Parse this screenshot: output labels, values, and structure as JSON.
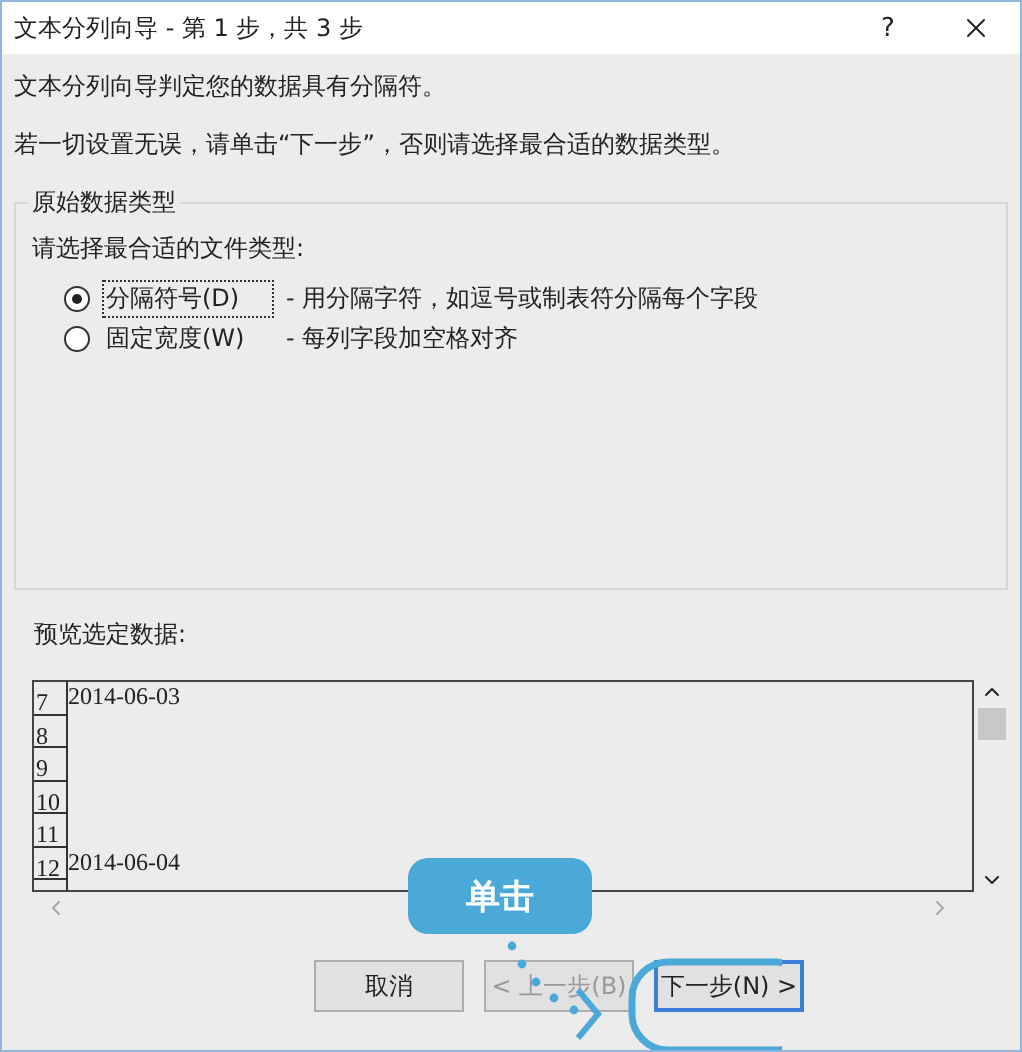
{
  "window": {
    "title": "文本分列向导 - 第 1 步，共 3 步",
    "help": "?"
  },
  "intro": [
    "文本分列向导判定您的数据具有分隔符。",
    "若一切设置无误，请单击“下一步”，否则请选择最合适的数据类型。"
  ],
  "group": {
    "title": "原始数据类型",
    "prompt": "请选择最合适的文件类型:",
    "options": [
      {
        "label": "分隔符号(D)",
        "description": "- 用分隔字符，如逗号或制表符分隔每个字段",
        "selected": true
      },
      {
        "label": "固定宽度(W)",
        "description": "- 每列字段加空格对齐",
        "selected": false
      }
    ]
  },
  "preview": {
    "label": "预览选定数据:",
    "rows": [
      {
        "number": "7",
        "value": "2014-06-03"
      },
      {
        "number": "8"
      },
      {
        "number": "9"
      },
      {
        "number": "10"
      },
      {
        "number": "11"
      },
      {
        "number": "12",
        "value": "2014-06-04"
      }
    ]
  },
  "buttons": [
    {
      "label": "取消",
      "disabled": false,
      "default": false
    },
    {
      "label": "< 上一步(B)",
      "disabled": true,
      "default": false
    },
    {
      "label": "下一步(N) >",
      "disabled": false,
      "default": true
    }
  ],
  "callout": {
    "label": "单击"
  }
}
